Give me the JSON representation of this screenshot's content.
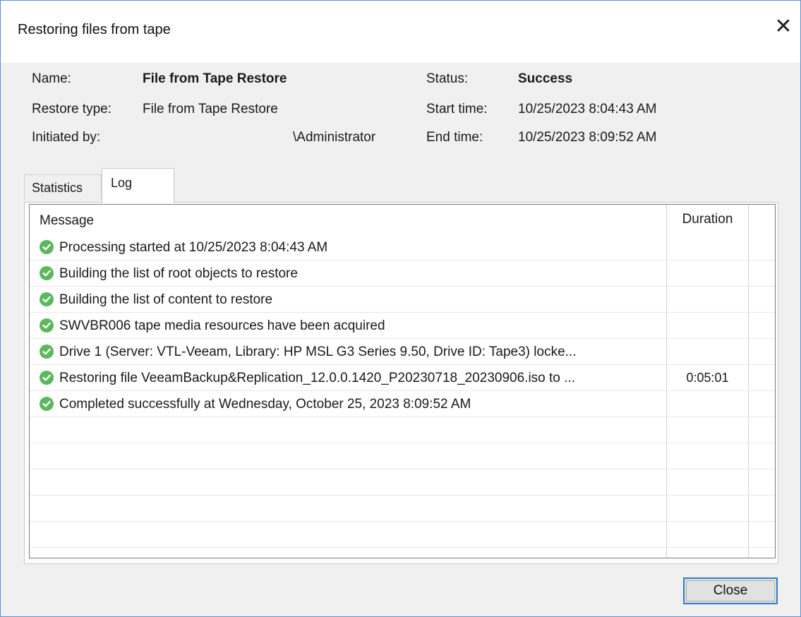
{
  "window": {
    "title": "Restoring files from tape",
    "close_glyph": "✕"
  },
  "summary": {
    "name_label": "Name:",
    "name_value": "File from Tape Restore",
    "restore_type_label": "Restore type:",
    "restore_type_value": "File from Tape Restore",
    "initiated_by_label": "Initiated by:",
    "initiated_by_value": "\\Administrator",
    "status_label": "Status:",
    "status_value": "Success",
    "start_time_label": "Start time:",
    "start_time_value": "10/25/2023 8:04:43 AM",
    "end_time_label": "End time:",
    "end_time_value": "10/25/2023 8:09:52 AM"
  },
  "tabs": [
    {
      "label": "Statistics",
      "active": false
    },
    {
      "label": "Log",
      "active": true
    }
  ],
  "log": {
    "columns": {
      "message": "Message",
      "duration": "Duration"
    },
    "rows": [
      {
        "icon": "success-check-icon",
        "message": "Processing started at 10/25/2023 8:04:43 AM",
        "duration": ""
      },
      {
        "icon": "success-check-icon",
        "message": "Building the list of root objects to restore",
        "duration": ""
      },
      {
        "icon": "success-check-icon",
        "message": "Building the list of content to restore",
        "duration": ""
      },
      {
        "icon": "success-check-icon",
        "message": "SWVBR006 tape media resources have been acquired",
        "duration": ""
      },
      {
        "icon": "success-check-icon",
        "message": "Drive 1 (Server: VTL-Veeam, Library: HP MSL G3 Series 9.50, Drive ID: Tape3) locke...",
        "duration": ""
      },
      {
        "icon": "success-check-icon",
        "message": "Restoring file VeeamBackup&Replication_12.0.0.1420_P20230718_20230906.iso to ...",
        "duration": "0:05:01"
      },
      {
        "icon": "success-check-icon",
        "message": "Completed successfully at Wednesday, October 25, 2023 8:09:52 AM",
        "duration": ""
      }
    ]
  },
  "buttons": {
    "close_label": "Close"
  },
  "colors": {
    "success": "#5cb85c",
    "accent_border": "#2f7bd6",
    "window_border": "#5a8fd6"
  }
}
